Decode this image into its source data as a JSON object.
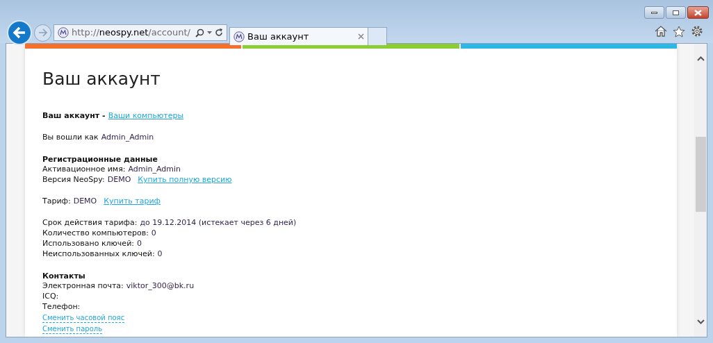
{
  "browser": {
    "url_scheme": "http://",
    "url_host": "neospy.net",
    "url_path": "/account/",
    "tab_title": "Ваш аккаунт"
  },
  "page": {
    "title": "Ваш аккаунт",
    "blocks": [
      [
        {
          "kind": "nav",
          "label": "Ваш аккаунт -",
          "link": "Ваши компьютеры"
        }
      ],
      [
        {
          "kind": "field",
          "label": "Вы вошли как",
          "value": "Admin_Admin"
        }
      ],
      [
        {
          "kind": "heading",
          "label": "Регистрационные данные"
        },
        {
          "kind": "field",
          "label": "Активационное имя:",
          "value": "Admin_Admin"
        },
        {
          "kind": "field",
          "label": "Версия NeoSpy:",
          "value": "DEMO",
          "link": "Купить полную версию"
        }
      ],
      [
        {
          "kind": "field",
          "label": "Тариф:",
          "value": "DEMO",
          "link": "Купить тариф"
        }
      ],
      [
        {
          "kind": "field",
          "label": "Срок действия тарифа:",
          "value": "до 19.12.2014 (истекает через 6 дней)"
        },
        {
          "kind": "field",
          "label": "Количество компьютеров:",
          "value": "0"
        },
        {
          "kind": "field",
          "label": "Использовано ключей:",
          "value": "0"
        },
        {
          "kind": "field",
          "label": "Неиспользованных ключей:",
          "value": "0"
        }
      ],
      [
        {
          "kind": "heading",
          "label": "Контакты"
        },
        {
          "kind": "field",
          "label": "Электронная почта:",
          "value": "viktor_300@bk.ru"
        },
        {
          "kind": "field",
          "label": "ICQ:"
        },
        {
          "kind": "field",
          "label": "Телефон:"
        },
        {
          "kind": "action",
          "label": "Сменить часовой пояс"
        },
        {
          "kind": "action",
          "label": "Сменить пароль"
        }
      ]
    ]
  }
}
